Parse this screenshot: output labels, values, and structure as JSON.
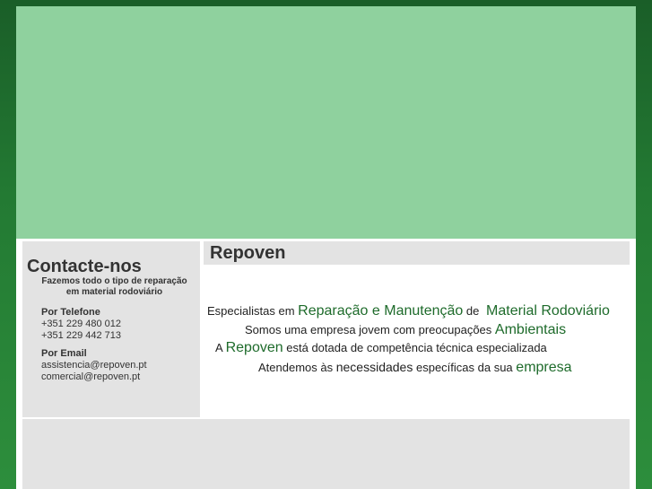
{
  "sidebar": {
    "title": "Contacte-nos",
    "tagline_line1": "Fazemos todo o tipo de reparação",
    "tagline_line2": "em material rodoviário",
    "phone": {
      "label": "Por Telefone",
      "numbers": [
        "+351 229 480 012",
        "+351 229 442 713"
      ]
    },
    "email": {
      "label": "Por Email",
      "addresses": [
        "assistencia@repoven.pt",
        "comercial@repoven.pt"
      ]
    }
  },
  "main": {
    "title": "Repoven",
    "line1": {
      "a": "Especialistas em",
      "b": "Reparação e Manutenção",
      "c": "de",
      "d": "Material Rodoviário"
    },
    "line2": {
      "a": "Somos uma empresa jovem com preocupações",
      "b": "Ambientais"
    },
    "line3": {
      "a": "A",
      "b": "Repoven",
      "c": "está dotada de competência técnica especializada"
    },
    "line4": {
      "a": "Atendemos às",
      "b": "necessidades",
      "c": "específicas da sua",
      "d": "empresa"
    }
  },
  "colors": {
    "background": "#237a33",
    "banner": "#8fd19e",
    "panel": "#e3e3e3",
    "highlight": "#1e6b2b"
  }
}
